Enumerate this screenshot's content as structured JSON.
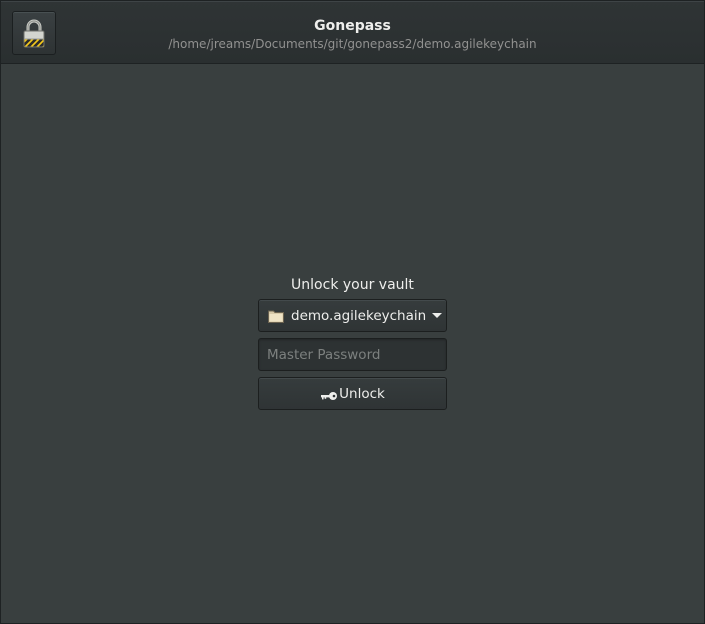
{
  "header": {
    "title": "Gonepass",
    "subtitle": "/home/jreams/Documents/git/gonepass2/demo.agilekeychain",
    "lock_icon": "padlock-icon"
  },
  "unlock": {
    "heading": "Unlock your vault",
    "vault_selected": "demo.agilekeychain",
    "vault_icon": "folder-icon",
    "password_placeholder": "Master Password",
    "password_value": "",
    "button_label": "Unlock",
    "button_icon": "key-icon"
  },
  "colors": {
    "background": "#393f3f",
    "headerbar": "#2f3435",
    "text": "#eeeeec",
    "subtitle": "#919190"
  }
}
